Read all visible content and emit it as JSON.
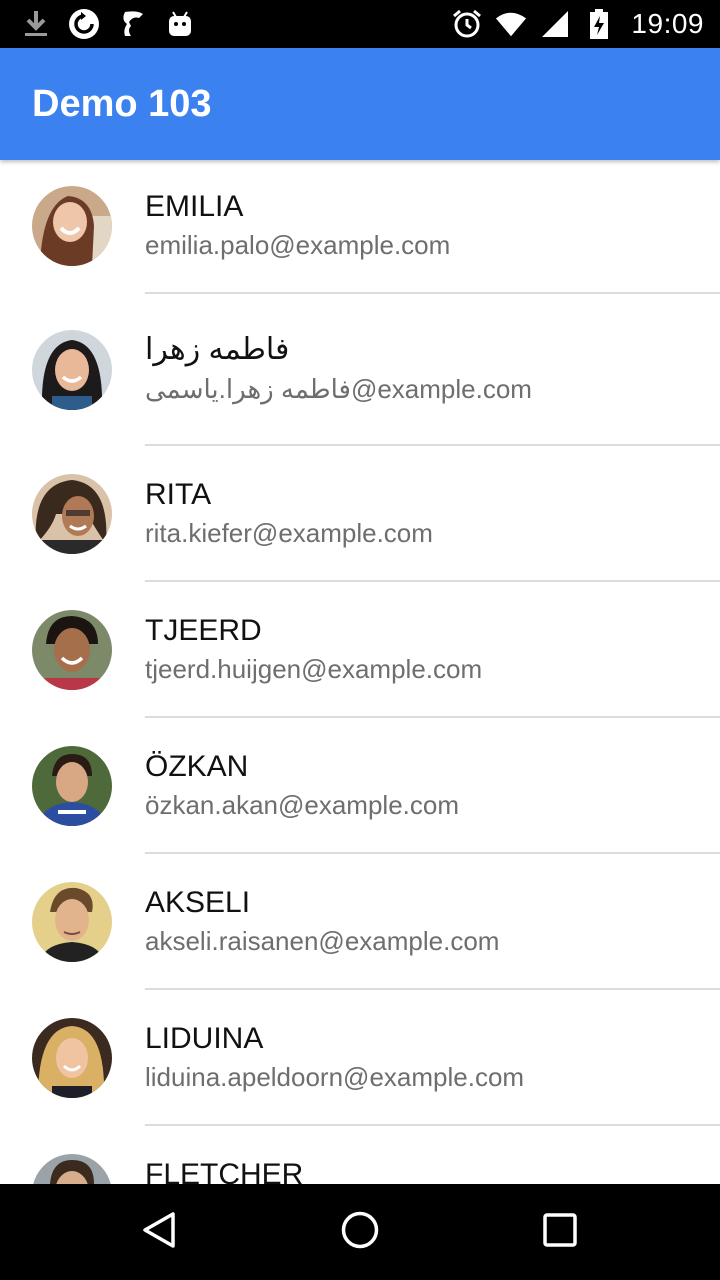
{
  "status_bar": {
    "time": "19:09",
    "left_icons": [
      "download-icon",
      "sync-icon",
      "coffee-icon",
      "android-icon"
    ],
    "right_icons": [
      "alarm-icon",
      "wifi-icon",
      "signal-icon",
      "battery-icon"
    ]
  },
  "app_bar": {
    "title": "Demo 103",
    "color": "#3b82f0"
  },
  "contacts": [
    {
      "name": "EMILIA",
      "email": "emilia.palo@example.com"
    },
    {
      "name": "فاطمه زهرا",
      "email": "فاطمه زهرا.یاسمی@example.com"
    },
    {
      "name": "RITA",
      "email": "rita.kiefer@example.com"
    },
    {
      "name": "TJEERD",
      "email": "tjeerd.huijgen@example.com"
    },
    {
      "name": "ÖZKAN",
      "email": "özkan.akan@example.com"
    },
    {
      "name": "AKSELI",
      "email": "akseli.raisanen@example.com"
    },
    {
      "name": "LIDUINA",
      "email": "liduina.apeldoorn@example.com"
    },
    {
      "name": "FLETCHER",
      "email": ""
    }
  ],
  "nav_bar": {
    "icons": [
      "back-icon",
      "home-icon",
      "recents-icon"
    ]
  }
}
